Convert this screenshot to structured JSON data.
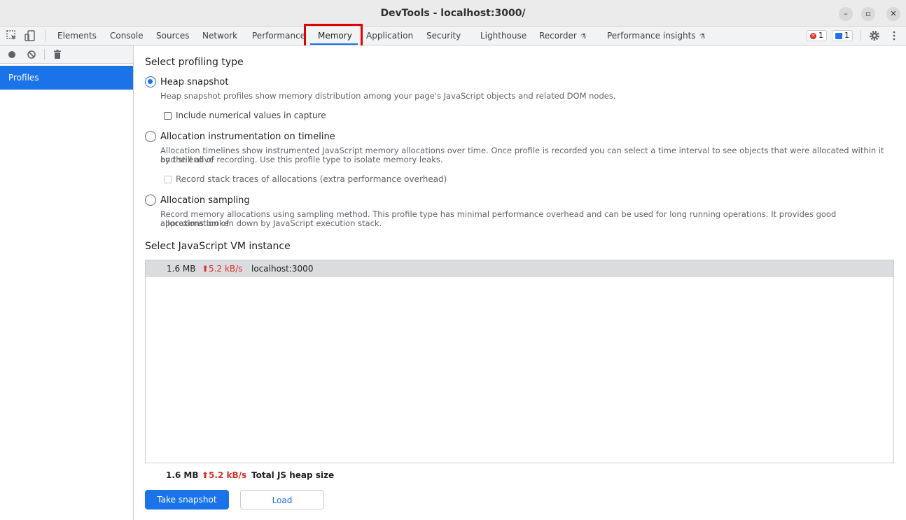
{
  "window": {
    "title": "DevTools - localhost:3000/",
    "controls": {
      "minimize": "–",
      "restore": "▫",
      "close": "✕"
    }
  },
  "tabs": [
    {
      "label": "Elements"
    },
    {
      "label": "Console"
    },
    {
      "label": "Sources"
    },
    {
      "label": "Network"
    },
    {
      "label": "Performance"
    },
    {
      "label": "Memory"
    },
    {
      "label": "Application"
    },
    {
      "label": "Security"
    },
    {
      "label": "Lighthouse"
    },
    {
      "label": "Recorder"
    },
    {
      "label": "Performance insights"
    }
  ],
  "active_tab": "Memory",
  "badges": {
    "errors": "1",
    "messages": "1"
  },
  "sidebar": {
    "items": [
      {
        "label": "Profiles"
      }
    ]
  },
  "main": {
    "profiling_heading": "Select profiling type",
    "options": [
      {
        "label": "Heap snapshot",
        "description": "Heap snapshot profiles show memory distribution among your page's JavaScript objects and related DOM nodes.",
        "checkbox": "Include numerical values in capture",
        "selected": true
      },
      {
        "label": "Allocation instrumentation on timeline",
        "description_1": "Allocation timelines show instrumented JavaScript memory allocations over time. Once profile is recorded you can select a time interval to see objects that were allocated within it and still alive",
        "description_2": "by the end of recording. Use this profile type to isolate memory leaks.",
        "checkbox": "Record stack traces of allocations (extra performance overhead)",
        "selected": false
      },
      {
        "label": "Allocation sampling",
        "description_1": "Record memory allocations using sampling method. This profile type has minimal performance overhead and can be used for long running operations. It provides good approximation of",
        "description_2": "allocations broken down by JavaScript execution stack.",
        "selected": false
      }
    ],
    "vm_heading": "Select JavaScript VM instance",
    "vm_instances": [
      {
        "size": "1.6 MB",
        "rate": "⬆5.2 kB/s",
        "name": "localhost:3000"
      }
    ],
    "totals": {
      "size": "1.6 MB",
      "rate": "⬆5.2 kB/s",
      "label": "Total JS heap size"
    },
    "buttons": {
      "take_snapshot": "Take snapshot",
      "load": "Load"
    }
  },
  "colors": {
    "accent": "#1a73e8",
    "error": "#d93025",
    "highlight": "#e00000"
  }
}
